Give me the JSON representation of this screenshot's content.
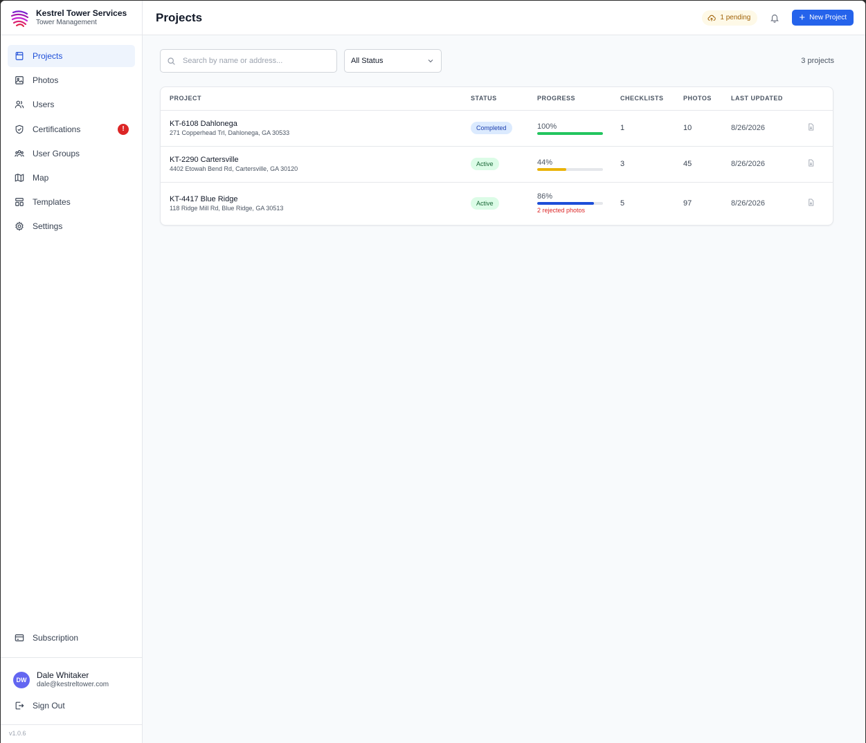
{
  "brand": {
    "name": "Kestrel Tower Services",
    "subtitle": "Tower Management"
  },
  "sidebar": {
    "items": [
      {
        "label": "Projects",
        "icon": "folder-icon",
        "active": true
      },
      {
        "label": "Photos",
        "icon": "image-icon"
      },
      {
        "label": "Users",
        "icon": "users-icon"
      },
      {
        "label": "Certifications",
        "icon": "shield-check-icon",
        "badge": "!"
      },
      {
        "label": "User Groups",
        "icon": "user-group-icon"
      },
      {
        "label": "Map",
        "icon": "map-icon"
      },
      {
        "label": "Templates",
        "icon": "layout-template-icon"
      },
      {
        "label": "Settings",
        "icon": "gear-icon"
      }
    ],
    "subscription_label": "Subscription",
    "user": {
      "initials": "DW",
      "name": "Dale Whitaker",
      "email": "dale@kestreltower.com"
    },
    "signout_label": "Sign Out",
    "version": "v1.0.6"
  },
  "header": {
    "title": "Projects",
    "pending": "1 pending",
    "new_project_label": "New Project"
  },
  "toolbar": {
    "search_placeholder": "Search by name or address...",
    "status_filter": "All Status",
    "count": "3 projects"
  },
  "table": {
    "columns": [
      "PROJECT",
      "STATUS",
      "PROGRESS",
      "CHECKLISTS",
      "PHOTOS",
      "LAST UPDATED"
    ],
    "rows": [
      {
        "name": "KT-6108 Dahlonega",
        "address": "271 Copperhead Trl, Dahlonega, GA 30533",
        "status": "Completed",
        "progress_label": "100%",
        "progress": 100,
        "progress_color": "#22c55e",
        "rejected": "",
        "checklists": "1",
        "photos": "10",
        "updated": "8/26/2026"
      },
      {
        "name": "KT-2290 Cartersville",
        "address": "4402 Etowah Bend Rd, Cartersville, GA 30120",
        "status": "Active",
        "progress_label": "44%",
        "progress": 44,
        "progress_color": "#eab308",
        "rejected": "",
        "checklists": "3",
        "photos": "45",
        "updated": "8/26/2026"
      },
      {
        "name": "KT-4417 Blue Ridge",
        "address": "118 Ridge Mill Rd, Blue Ridge, GA 30513",
        "status": "Active",
        "progress_label": "86%",
        "progress": 86,
        "progress_color": "#1d4ed8",
        "rejected": "2 rejected photos",
        "checklists": "5",
        "photos": "97",
        "updated": "8/26/2026"
      }
    ]
  },
  "colors": {
    "accent": "#2563eb",
    "active_nav_bg": "#eef4fd",
    "alert": "#dc2626"
  }
}
